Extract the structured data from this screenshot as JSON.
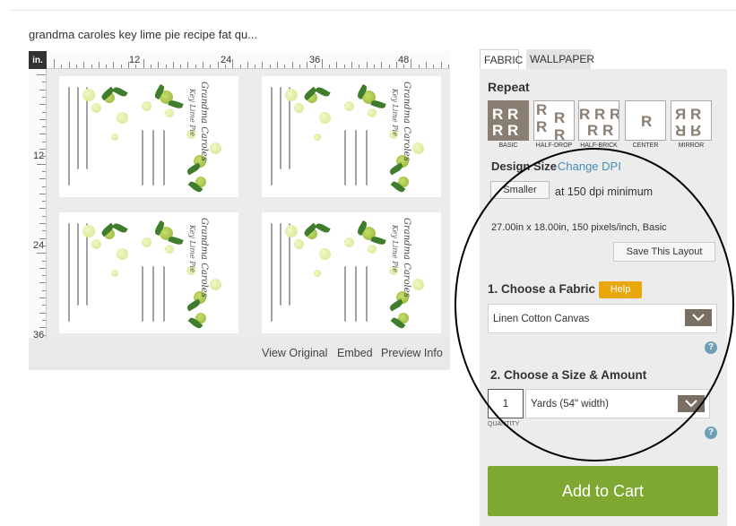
{
  "page": {
    "title": "grandma caroles key lime pie recipe fat qu..."
  },
  "ruler": {
    "unit": "in.",
    "top_labels": [
      "12",
      "24",
      "36",
      "48"
    ],
    "left_labels": [
      "12",
      "24",
      "36"
    ]
  },
  "tiles": {
    "script_title": "Grandma Caroles",
    "script_subtitle": "Key Lime Pie"
  },
  "preview_links": {
    "view_original": "View Original",
    "embed": "Embed",
    "preview_info": "Preview Info"
  },
  "tabs": [
    {
      "label": "FABRIC",
      "active": true
    },
    {
      "label": "WALLPAPER",
      "active": false
    }
  ],
  "repeat": {
    "title": "Repeat",
    "options": [
      {
        "label": "BASIC",
        "selected": true
      },
      {
        "label": "HALF-DROP",
        "selected": false
      },
      {
        "label": "HALF-BRICK",
        "selected": false
      },
      {
        "label": "CENTER",
        "selected": false
      },
      {
        "label": "MIRROR",
        "selected": false
      }
    ],
    "glyph": "R"
  },
  "design_size": {
    "title": "Design Size",
    "change_dpi": "Change DPI",
    "smaller_button": "Smaller",
    "dpi_text": "at 150 dpi minimum",
    "dimensions": "27.00in x 18.00in, 150 pixels/inch, Basic",
    "save_layout": "Save This Layout"
  },
  "fabric": {
    "heading": "1. Choose a Fabric",
    "help": "Help",
    "selected": "Linen Cotton Canvas",
    "info_icon": "?"
  },
  "size": {
    "heading": "2. Choose a Size & Amount",
    "quantity": "1",
    "quantity_label": "QUANTITY",
    "selected": "Yards (54\" width)",
    "info_icon": "?"
  },
  "cart": {
    "label": "Add to Cart"
  },
  "colors": {
    "accent_green": "#7fa832",
    "help_orange": "#e8a80c",
    "select_brown": "#7b6e63",
    "link_blue": "#4a8bb5"
  }
}
